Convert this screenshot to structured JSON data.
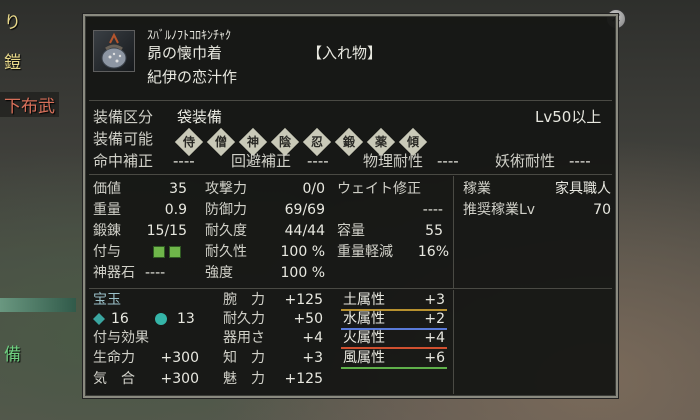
{
  "background": {
    "left_labels": [
      "り",
      "鎧",
      "下布武",
      "備"
    ]
  },
  "item": {
    "kana_name": "ｽﾊﾞﾙﾉﾌﾄｺﾛｷﾝﾁｬｸ",
    "name": "昴の懐巾着",
    "category_tag": "【入れ物】",
    "author": "紀伊の恋汁作",
    "icon": "pouch-icon"
  },
  "equip": {
    "slot_label": "装備区分",
    "slot_value": "袋装備",
    "level_req": "Lv50以上",
    "classes_label": "装備可能",
    "classes": [
      "侍",
      "僧",
      "神",
      "陰",
      "忍",
      "鍛",
      "薬",
      "傾"
    ]
  },
  "corrections": [
    {
      "label": "命中補正",
      "value": "----"
    },
    {
      "label": "回避補正",
      "value": "----"
    },
    {
      "label": "物理耐性",
      "value": "----"
    },
    {
      "label": "妖術耐性",
      "value": "----"
    }
  ],
  "stats_left": [
    {
      "label": "価値",
      "value": "35"
    },
    {
      "label": "重量",
      "value": "0.9"
    },
    {
      "label": "鍛錬",
      "value": "15/15"
    },
    {
      "label": "付与",
      "value": ""
    },
    {
      "label": "神器石",
      "value": "----"
    }
  ],
  "stats_mid": [
    {
      "label": "攻撃力",
      "value": "0/0"
    },
    {
      "label": "防御力",
      "value": "69/69"
    },
    {
      "label": "耐久度",
      "value": "44/44"
    },
    {
      "label": "耐久性",
      "value": "100 %"
    },
    {
      "label": "強度",
      "value": "100 %"
    }
  ],
  "stats_right": [
    {
      "label": "ウェイト修正",
      "value": "----"
    },
    {
      "label": "容量",
      "value": "55"
    },
    {
      "label": "重量軽減",
      "value": "16%"
    }
  ],
  "trade": [
    {
      "label": "稼業",
      "value": "家具職人"
    },
    {
      "label": "推奨稼業Lv",
      "value": "70"
    }
  ],
  "gems": {
    "title": "宝玉",
    "counts": [
      "16",
      "13"
    ],
    "colors": [
      "#3aa6a0",
      "#35b5a8"
    ]
  },
  "effects_title": "付与効果",
  "effects_left": [
    {
      "label": "生命力",
      "value": "+300"
    },
    {
      "label": "気　合",
      "value": "+300"
    }
  ],
  "effects_mid": [
    {
      "label": "腕　力",
      "value": "+125"
    },
    {
      "label": "耐久力",
      "value": "+50"
    },
    {
      "label": "器用さ",
      "value": "+4"
    },
    {
      "label": "知　力",
      "value": "+3"
    },
    {
      "label": "魅　力",
      "value": "+125"
    }
  ],
  "elements": [
    {
      "label": "土属性",
      "value": "+3",
      "color": "#b8912f"
    },
    {
      "label": "水属性",
      "value": "+2",
      "color": "#5a7ad8"
    },
    {
      "label": "火属性",
      "value": "+4",
      "color": "#d05030"
    },
    {
      "label": "風属性",
      "value": "+6",
      "color": "#5fb04a"
    }
  ],
  "colors": {
    "enchant_squares": "#6fb64a"
  }
}
